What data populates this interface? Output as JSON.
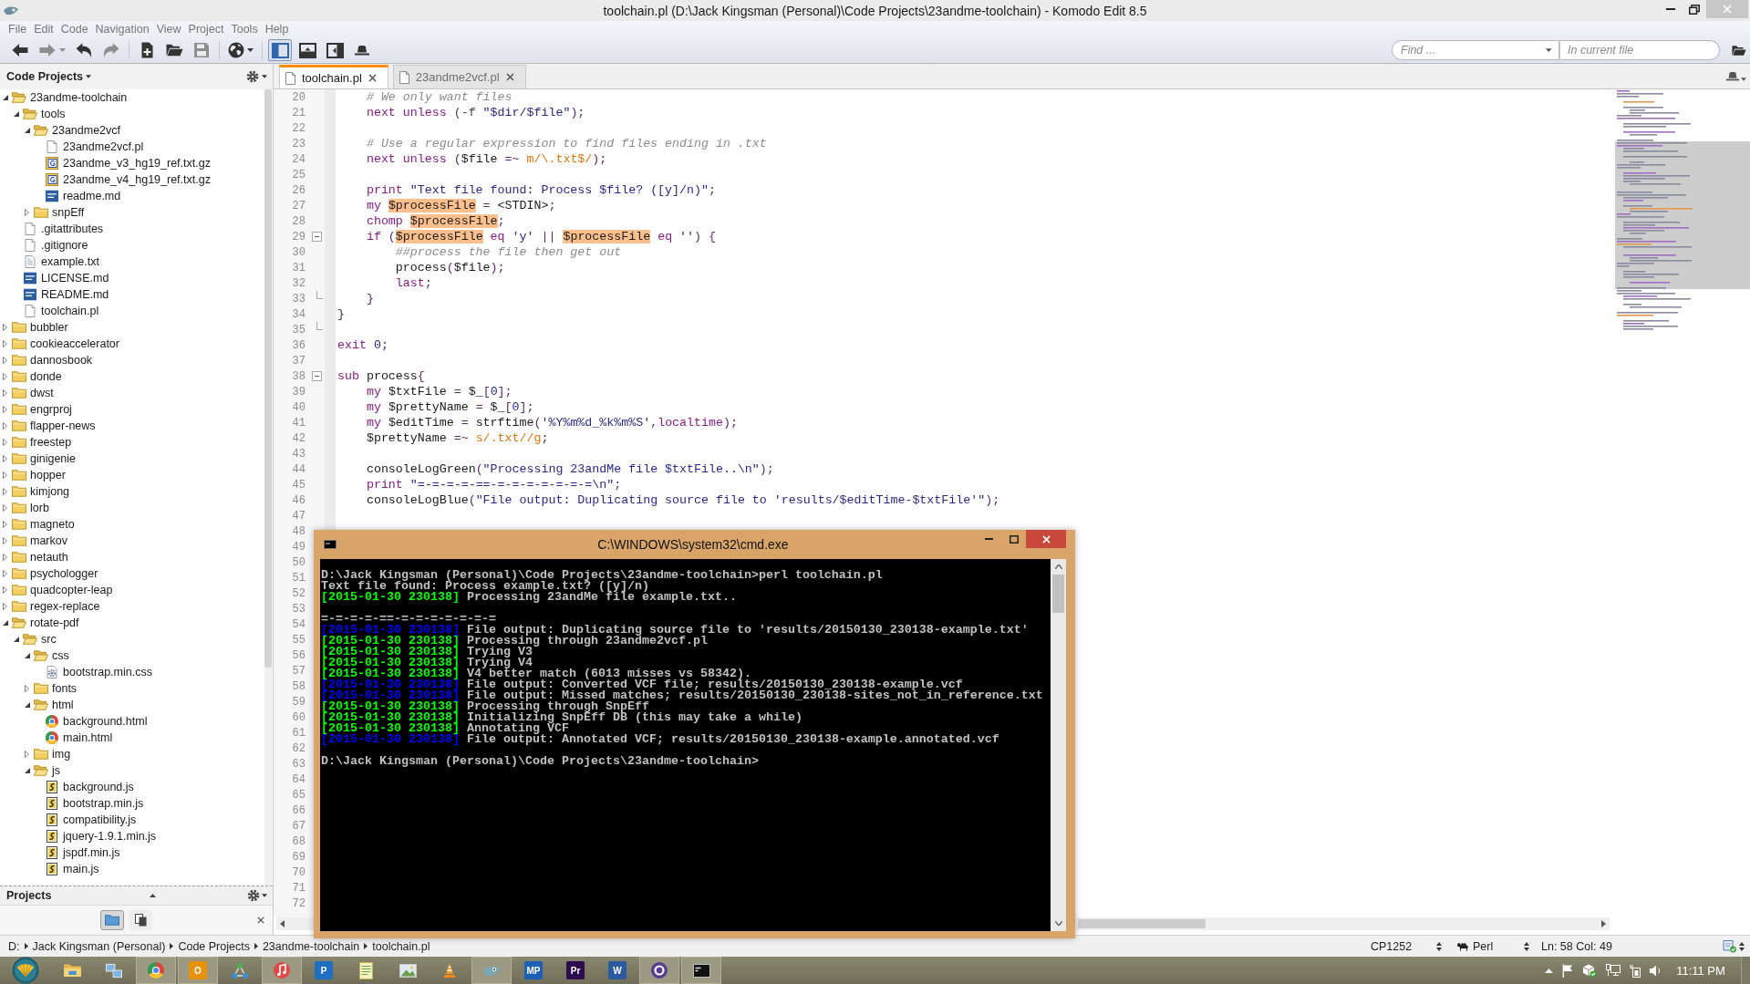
{
  "window": {
    "title": "toolchain.pl (D:\\Jack Kingsman (Personal)\\Code Projects\\23andme-toolchain) - Komodo Edit 8.5"
  },
  "menu": [
    "File",
    "Edit",
    "Code",
    "Navigation",
    "View",
    "Project",
    "Tools",
    "Help"
  ],
  "toolbar": {
    "groups": [
      [
        {
          "kind": "back",
          "disabled": false,
          "dropdown": false
        },
        {
          "kind": "forward",
          "disabled": true,
          "dropdown": true
        },
        {
          "kind": "undo",
          "disabled": false,
          "dropdown": false
        },
        {
          "kind": "redo",
          "disabled": true,
          "dropdown": false
        }
      ],
      [
        {
          "kind": "new-file",
          "disabled": false,
          "dropdown": false
        },
        {
          "kind": "open",
          "disabled": false,
          "dropdown": false
        },
        {
          "kind": "save",
          "disabled": true,
          "dropdown": false
        }
      ],
      [
        {
          "kind": "globe",
          "disabled": false,
          "dropdown": true
        }
      ],
      [
        {
          "kind": "left-pane",
          "disabled": false,
          "dropdown": false,
          "pressed": true
        },
        {
          "kind": "bottom-pane",
          "disabled": false,
          "dropdown": false,
          "pressed": false
        },
        {
          "kind": "right-pane",
          "disabled": false,
          "dropdown": false,
          "pressed": false
        },
        {
          "kind": "hat",
          "disabled": false,
          "dropdown": false,
          "pressed": false
        }
      ]
    ]
  },
  "find": {
    "query": {
      "placeholder": "Find ..."
    },
    "scope": {
      "placeholder": "In current file"
    }
  },
  "left_panel": {
    "title": "Code Projects",
    "tree": [
      {
        "name": "23andme-toolchain",
        "kind": "folder",
        "expanded": true,
        "children": [
          {
            "name": "tools",
            "kind": "folder",
            "expanded": true,
            "children": [
              {
                "name": "23andme2vcf",
                "kind": "folder",
                "expanded": true,
                "children": [
                  {
                    "name": "23andme2vcf.pl",
                    "kind": "file"
                  },
                  {
                    "name": "23andme_v3_hg19_ref.txt.gz",
                    "kind": "archive"
                  },
                  {
                    "name": "23andme_v4_hg19_ref.txt.gz",
                    "kind": "archive"
                  },
                  {
                    "name": "readme.md",
                    "kind": "markdown"
                  }
                ]
              },
              {
                "name": "snpEff",
                "kind": "folder",
                "expanded": false
              }
            ]
          },
          {
            "name": ".gitattributes",
            "kind": "file"
          },
          {
            "name": ".gitignore",
            "kind": "file"
          },
          {
            "name": "example.txt",
            "kind": "text"
          },
          {
            "name": "LICENSE.md",
            "kind": "markdown"
          },
          {
            "name": "README.md",
            "kind": "markdown"
          },
          {
            "name": "toolchain.pl",
            "kind": "file"
          }
        ]
      },
      {
        "name": "bubbler",
        "kind": "folder",
        "expanded": false
      },
      {
        "name": "cookieaccelerator",
        "kind": "folder",
        "expanded": false
      },
      {
        "name": "dannosbook",
        "kind": "folder",
        "expanded": false
      },
      {
        "name": "donde",
        "kind": "folder",
        "expanded": false
      },
      {
        "name": "dwst",
        "kind": "folder",
        "expanded": false
      },
      {
        "name": "engrproj",
        "kind": "folder",
        "expanded": false
      },
      {
        "name": "flapper-news",
        "kind": "folder",
        "expanded": false
      },
      {
        "name": "freestep",
        "kind": "folder",
        "expanded": false
      },
      {
        "name": "ginigenie",
        "kind": "folder",
        "expanded": false
      },
      {
        "name": "hopper",
        "kind": "folder",
        "expanded": false
      },
      {
        "name": "kimjong",
        "kind": "folder",
        "expanded": false
      },
      {
        "name": "lorb",
        "kind": "folder",
        "expanded": false
      },
      {
        "name": "magneto",
        "kind": "folder",
        "expanded": false
      },
      {
        "name": "markov",
        "kind": "folder",
        "expanded": false
      },
      {
        "name": "netauth",
        "kind": "folder",
        "expanded": false
      },
      {
        "name": "psychologger",
        "kind": "folder",
        "expanded": false
      },
      {
        "name": "quadcopter-leap",
        "kind": "folder",
        "expanded": false
      },
      {
        "name": "regex-replace",
        "kind": "folder",
        "expanded": false
      },
      {
        "name": "rotate-pdf",
        "kind": "folder",
        "expanded": true,
        "children": [
          {
            "name": "src",
            "kind": "folder",
            "expanded": true,
            "children": [
              {
                "name": "css",
                "kind": "folder",
                "expanded": true,
                "children": [
                  {
                    "name": "bootstrap.min.css",
                    "kind": "stylesheet"
                  }
                ]
              },
              {
                "name": "fonts",
                "kind": "folder",
                "expanded": false
              },
              {
                "name": "html",
                "kind": "folder",
                "expanded": true,
                "children": [
                  {
                    "name": "background.html",
                    "kind": "web"
                  },
                  {
                    "name": "main.html",
                    "kind": "web"
                  }
                ]
              },
              {
                "name": "img",
                "kind": "folder",
                "expanded": false
              },
              {
                "name": "js",
                "kind": "folder",
                "expanded": true,
                "children": [
                  {
                    "name": "background.js",
                    "kind": "script"
                  },
                  {
                    "name": "bootstrap.min.js",
                    "kind": "script"
                  },
                  {
                    "name": "compatibility.js",
                    "kind": "script"
                  },
                  {
                    "name": "jquery-1.9.1.min.js",
                    "kind": "script"
                  },
                  {
                    "name": "jspdf.min.js",
                    "kind": "script"
                  },
                  {
                    "name": "main.js",
                    "kind": "script"
                  }
                ]
              }
            ]
          }
        ]
      }
    ]
  },
  "projects_panel": {
    "title": "Projects",
    "buttons": [
      {
        "kind": "folder",
        "selected": true
      },
      {
        "kind": "pages",
        "selected": false
      }
    ]
  },
  "editor": {
    "tabs": [
      {
        "label": "toolchain.pl",
        "selected": true
      },
      {
        "label": "23andme2vcf.pl",
        "selected": false
      }
    ],
    "lines": [
      {
        "number": "20",
        "kind": "plain",
        "tokens": [
          {
            "kind": "comment",
            "text": "    # We only want files"
          }
        ]
      },
      {
        "number": "21",
        "kind": "plain",
        "tokens": [
          {
            "kind": "keyword",
            "text": "    next unless"
          },
          {
            "kind": "op",
            "text": " (-f "
          },
          {
            "kind": "string",
            "text": "\"$dir/$file\""
          },
          {
            "kind": "op",
            "text": ");"
          }
        ]
      },
      {
        "number": "22",
        "kind": "plain"
      },
      {
        "number": "23",
        "kind": "plain",
        "tokens": [
          {
            "kind": "comment",
            "text": "    # Use a regular expression to find files ending in .txt"
          }
        ]
      },
      {
        "number": "24",
        "kind": "plain",
        "tokens": [
          {
            "kind": "keyword",
            "text": "    next unless"
          },
          {
            "kind": "op",
            "text": " ("
          },
          {
            "kind": "text",
            "text": "$file"
          },
          {
            "kind": "op",
            "text": " =~ "
          },
          {
            "kind": "regex",
            "text": "m/\\.txt$/"
          },
          {
            "kind": "op",
            "text": ");"
          }
        ]
      },
      {
        "number": "25",
        "kind": "plain"
      },
      {
        "number": "26",
        "kind": "plain",
        "tokens": [
          {
            "kind": "keyword",
            "text": "    print"
          },
          {
            "kind": "string",
            "text": " \"Text file found: Process $file? ([y]/n)\""
          },
          {
            "kind": "op",
            "text": ";"
          }
        ]
      },
      {
        "number": "27",
        "kind": "plain",
        "tokens": [
          {
            "kind": "keyword",
            "text": "    my "
          },
          {
            "kind": "match",
            "text": "$processFile"
          },
          {
            "kind": "op",
            "text": " = "
          },
          {
            "kind": "text",
            "text": "<STDIN>"
          },
          {
            "kind": "op",
            "text": ";"
          }
        ]
      },
      {
        "number": "28",
        "kind": "plain",
        "tokens": [
          {
            "kind": "keyword",
            "text": "    chomp "
          },
          {
            "kind": "match",
            "text": "$processFile"
          },
          {
            "kind": "op",
            "text": ";"
          }
        ]
      },
      {
        "number": "29",
        "kind": "fold-start",
        "tokens": [
          {
            "kind": "keyword",
            "text": "    if"
          },
          {
            "kind": "op",
            "text": " ("
          },
          {
            "kind": "match",
            "text": "$processFile"
          },
          {
            "kind": "keyword",
            "text": " eq "
          },
          {
            "kind": "string",
            "text": "'y'"
          },
          {
            "kind": "op",
            "text": " || "
          },
          {
            "kind": "match",
            "text": "$processFile"
          },
          {
            "kind": "keyword",
            "text": " eq "
          },
          {
            "kind": "string",
            "text": "''"
          },
          {
            "kind": "op",
            "text": ") {"
          }
        ]
      },
      {
        "number": "30",
        "kind": "plain",
        "tokens": [
          {
            "kind": "comment",
            "text": "        ##process the file then get out"
          }
        ]
      },
      {
        "number": "31",
        "kind": "plain",
        "tokens": [
          {
            "kind": "text",
            "text": "        process"
          },
          {
            "kind": "op",
            "text": "("
          },
          {
            "kind": "text",
            "text": "$file"
          },
          {
            "kind": "op",
            "text": ");"
          }
        ]
      },
      {
        "number": "32",
        "kind": "plain",
        "tokens": [
          {
            "kind": "keyword",
            "text": "        last"
          },
          {
            "kind": "op",
            "text": ";"
          }
        ]
      },
      {
        "number": "33",
        "kind": "fold-end",
        "tokens": [
          {
            "kind": "op",
            "text": "    }"
          }
        ]
      },
      {
        "number": "34",
        "kind": "plain",
        "tokens": [
          {
            "kind": "op",
            "text": "}"
          }
        ]
      },
      {
        "number": "35",
        "kind": "fold-end"
      },
      {
        "number": "36",
        "kind": "plain",
        "tokens": [
          {
            "kind": "keyword",
            "text": "exit "
          },
          {
            "kind": "number",
            "text": "0"
          },
          {
            "kind": "op",
            "text": ";"
          }
        ]
      },
      {
        "number": "37",
        "kind": "plain"
      },
      {
        "number": "38",
        "kind": "fold-start",
        "tokens": [
          {
            "kind": "keyword",
            "text": "sub "
          },
          {
            "kind": "text",
            "text": "process"
          },
          {
            "kind": "op",
            "text": "{"
          }
        ]
      },
      {
        "number": "39",
        "kind": "plain",
        "tokens": [
          {
            "kind": "keyword",
            "text": "    my "
          },
          {
            "kind": "text",
            "text": "$txtFile "
          },
          {
            "kind": "op",
            "text": "= "
          },
          {
            "kind": "text",
            "text": "$_"
          },
          {
            "kind": "op",
            "text": "["
          },
          {
            "kind": "number",
            "text": "0"
          },
          {
            "kind": "op",
            "text": "];"
          }
        ]
      },
      {
        "number": "40",
        "kind": "plain",
        "tokens": [
          {
            "kind": "keyword",
            "text": "    my "
          },
          {
            "kind": "text",
            "text": "$prettyName "
          },
          {
            "kind": "op",
            "text": "= "
          },
          {
            "kind": "text",
            "text": "$_"
          },
          {
            "kind": "op",
            "text": "["
          },
          {
            "kind": "number",
            "text": "0"
          },
          {
            "kind": "op",
            "text": "];"
          }
        ]
      },
      {
        "number": "41",
        "kind": "plain",
        "tokens": [
          {
            "kind": "keyword",
            "text": "    my "
          },
          {
            "kind": "text",
            "text": "$editTime "
          },
          {
            "kind": "op",
            "text": "= "
          },
          {
            "kind": "text",
            "text": "strftime"
          },
          {
            "kind": "op",
            "text": "("
          },
          {
            "kind": "string",
            "text": "'%Y%m%d_%k%m%S'"
          },
          {
            "kind": "op",
            "text": ","
          },
          {
            "kind": "keyword",
            "text": "localtime"
          },
          {
            "kind": "op",
            "text": ");"
          }
        ]
      },
      {
        "number": "42",
        "kind": "plain",
        "tokens": [
          {
            "kind": "text",
            "text": "    $prettyName "
          },
          {
            "kind": "op",
            "text": "=~ "
          },
          {
            "kind": "regex",
            "text": "s/.txt//g"
          },
          {
            "kind": "op",
            "text": ";"
          }
        ]
      },
      {
        "number": "43",
        "kind": "plain"
      },
      {
        "number": "44",
        "kind": "plain",
        "tokens": [
          {
            "kind": "text",
            "text": "    consoleLogGreen"
          },
          {
            "kind": "op",
            "text": "("
          },
          {
            "kind": "string",
            "text": "\"Processing 23andMe file $txtFile..\\n\""
          },
          {
            "kind": "op",
            "text": ");"
          }
        ]
      },
      {
        "number": "45",
        "kind": "plain",
        "tokens": [
          {
            "kind": "keyword",
            "text": "    print "
          },
          {
            "kind": "string",
            "text": "\"=-=-=-=-==-=-=-=-=-=-=-=\\n\""
          },
          {
            "kind": "op",
            "text": ";"
          }
        ]
      },
      {
        "number": "46",
        "kind": "plain",
        "tokens": [
          {
            "kind": "text",
            "text": "    consoleLogBlue"
          },
          {
            "kind": "op",
            "text": "("
          },
          {
            "kind": "string",
            "text": "\"File output: Duplicating source file to 'results/$editTime-$txtFile'\""
          },
          {
            "kind": "op",
            "text": ");"
          }
        ]
      },
      {
        "number": "47",
        "kind": "plain"
      },
      {
        "number": "48",
        "kind": "plain"
      },
      {
        "number": "49",
        "kind": "plain"
      },
      {
        "number": "50",
        "kind": "plain"
      },
      {
        "number": "51",
        "kind": "plain"
      },
      {
        "number": "52",
        "kind": "plain"
      },
      {
        "number": "53",
        "kind": "plain"
      },
      {
        "number": "54",
        "kind": "plain"
      },
      {
        "number": "55",
        "kind": "plain"
      },
      {
        "number": "56",
        "kind": "plain"
      },
      {
        "number": "57",
        "kind": "plain"
      },
      {
        "number": "58",
        "kind": "plain"
      },
      {
        "number": "59",
        "kind": "plain"
      },
      {
        "number": "60",
        "kind": "plain"
      },
      {
        "number": "61",
        "kind": "plain"
      },
      {
        "number": "62",
        "kind": "plain"
      },
      {
        "number": "63",
        "kind": "plain"
      },
      {
        "number": "64",
        "kind": "plain"
      },
      {
        "number": "65",
        "kind": "plain"
      },
      {
        "number": "66",
        "kind": "plain"
      },
      {
        "number": "67",
        "kind": "plain"
      },
      {
        "number": "68",
        "kind": "plain"
      },
      {
        "number": "69",
        "kind": "plain"
      },
      {
        "number": "70",
        "kind": "plain"
      },
      {
        "number": "71",
        "kind": "plain"
      },
      {
        "number": "72",
        "kind": "plain"
      }
    ]
  },
  "console": {
    "title": "C:\\WINDOWS\\system32\\cmd.exe",
    "paragraphs": [
      [
        {
          "text": "D:\\Jack Kingsman (Personal)\\Code Projects\\23andme-toolchain>perl toolchain.pl"
        },
        {
          "text": "Text file found: Process example.txt? ([y]/n)"
        },
        {
          "stamp": "[2015-01-30 230138]",
          "color": "#00ff00",
          "text": "Processing 23andMe file example.txt.."
        }
      ],
      [
        {
          "text": "=-=-=-=-==-=-=-=-=-=-=-="
        },
        {
          "stamp": "[2015-01-30 230138]",
          "color": "#0000ff",
          "text": "File output: Duplicating source file to 'results/20150130_230138-example.txt'"
        },
        {
          "stamp": "[2015-01-30 230138]",
          "color": "#00ff00",
          "text": "Processing through 23andme2vcf.pl"
        },
        {
          "stamp": "[2015-01-30 230138]",
          "color": "#00ff00",
          "text": "Trying V3"
        },
        {
          "stamp": "[2015-01-30 230138]",
          "color": "#00ff00",
          "text": "Trying V4"
        },
        {
          "stamp": "[2015-01-30 230138]",
          "color": "#00ff00",
          "text": "V4 better match (6013 misses vs 58342)."
        },
        {
          "stamp": "[2015-01-30 230138]",
          "color": "#0000ff",
          "text": "File output: Converted VCF file; results/20150130_230138-example.vcf"
        },
        {
          "stamp": "[2015-01-30 230138]",
          "color": "#0000ff",
          "text": "File output: Missed matches; results/20150130_230138-sites_not_in_reference.txt"
        },
        {
          "stamp": "[2015-01-30 230138]",
          "color": "#00ff00",
          "text": "Processing through SnpEff"
        },
        {
          "stamp": "[2015-01-30 230138]",
          "color": "#00ff00",
          "text": "Initializing SnpEff DB (this may take a while)"
        },
        {
          "stamp": "[2015-01-30 230138]",
          "color": "#00ff00",
          "text": "Annotating VCF"
        },
        {
          "stamp": "[2015-01-30 230138]",
          "color": "#0000ff",
          "text": "File output: Annotated VCF; results/20150130_230138-example.annotated.vcf"
        }
      ],
      [
        {
          "text": "D:\\Jack Kingsman (Personal)\\Code Projects\\23andme-toolchain>"
        }
      ]
    ]
  },
  "status_bar": {
    "path": [
      "D:",
      "Jack Kingsman (Personal)",
      "Code Projects",
      "23andme-toolchain",
      "toolchain.pl"
    ],
    "encoding": "CP1252",
    "language": "Perl",
    "position": "Ln: 58 Col: 49"
  },
  "taskbar": {
    "apps": [
      {
        "kind": "folder",
        "running": false
      },
      {
        "kind": "network",
        "running": false
      },
      {
        "kind": "round-logo",
        "running": true
      },
      {
        "kind": "tile",
        "label": "O",
        "color": "#e8910c",
        "running": true
      },
      {
        "kind": "nodes",
        "running": false
      },
      {
        "kind": "music",
        "running": true
      },
      {
        "kind": "tile",
        "label": "P",
        "color": "#1f6fc0",
        "running": false
      },
      {
        "kind": "notepad",
        "running": false
      },
      {
        "kind": "picture",
        "running": false
      },
      {
        "kind": "cone",
        "running": false
      },
      {
        "kind": "app",
        "running": true
      },
      {
        "kind": "tile",
        "label": "MP",
        "color": "#1c5fb8",
        "running": false
      },
      {
        "kind": "tile",
        "label": "Pr",
        "color": "#2c0b4e",
        "running": false
      },
      {
        "kind": "tile",
        "label": "W",
        "color": "#2b5aa0",
        "running": false
      },
      {
        "kind": "ring",
        "running": true
      },
      {
        "kind": "terminal",
        "running": true
      }
    ],
    "clock": "11:11 PM"
  }
}
